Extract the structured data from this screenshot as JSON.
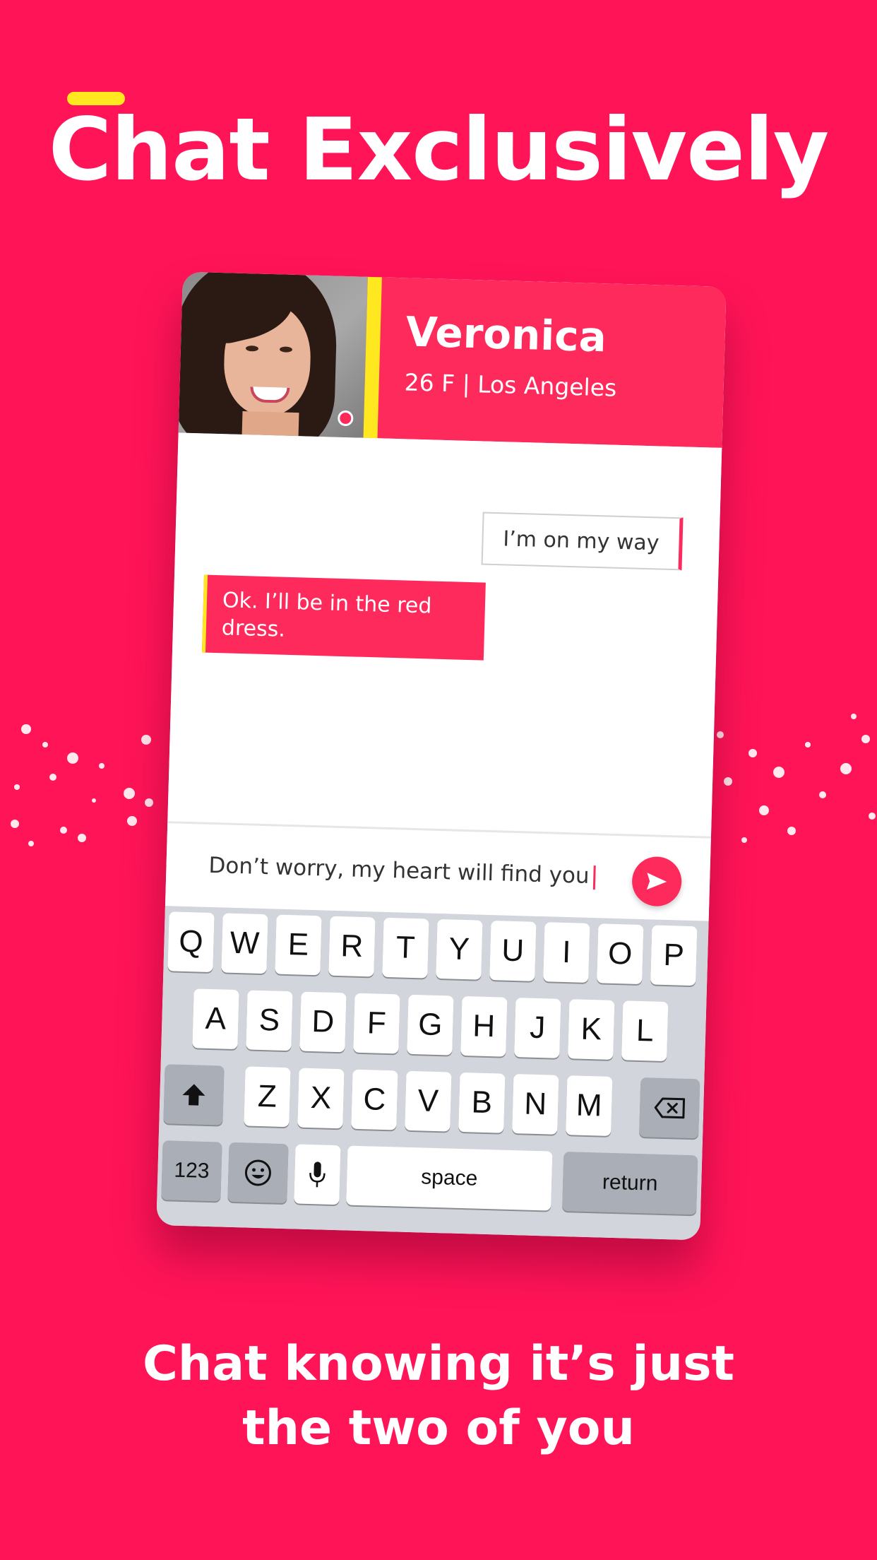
{
  "hero": {
    "title": "Chat Exclusively",
    "subtitle_line1": "Chat knowing it’s just",
    "subtitle_line2": "the two of you"
  },
  "profile": {
    "name": "Veronica",
    "details": "26 F | Los Angeles",
    "online": true
  },
  "messages": [
    {
      "direction": "outgoing",
      "text": "I’m on my way"
    },
    {
      "direction": "incoming",
      "text": "Ok. I’ll be in the red dress."
    }
  ],
  "composer": {
    "value": "Don’t worry, my heart will find you"
  },
  "keyboard": {
    "row1": [
      "Q",
      "W",
      "E",
      "R",
      "T",
      "Y",
      "U",
      "I",
      "O",
      "P"
    ],
    "row2": [
      "A",
      "S",
      "D",
      "F",
      "G",
      "H",
      "J",
      "K",
      "L"
    ],
    "row3": [
      "Z",
      "X",
      "C",
      "V",
      "B",
      "N",
      "M"
    ],
    "numbers_label": "123",
    "space_label": "space",
    "return_label": "return"
  },
  "colors": {
    "brand": "#ff1458",
    "accent_yellow": "#ffe81f"
  }
}
